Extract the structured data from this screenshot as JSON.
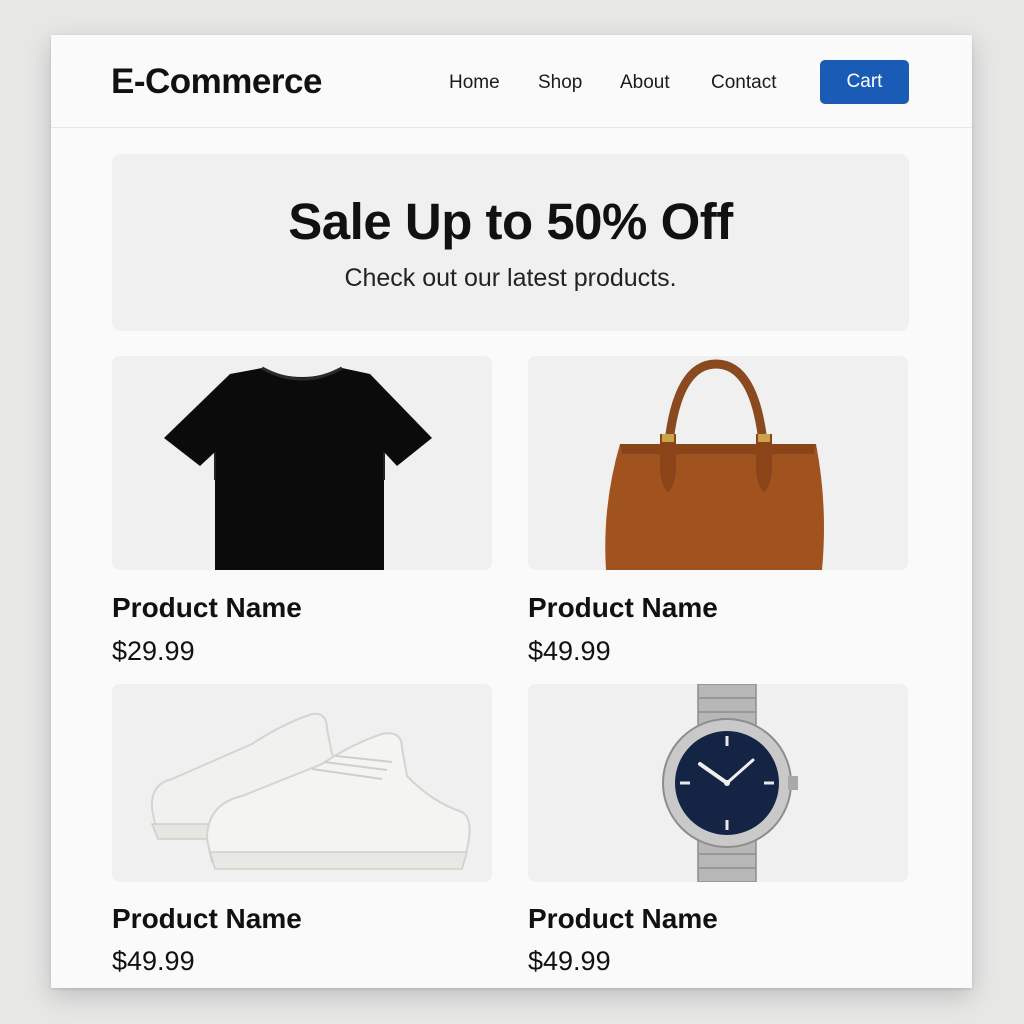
{
  "header": {
    "brand": "E-Commerce",
    "nav": [
      "Home",
      "Shop",
      "About",
      "Contact"
    ],
    "cart_label": "Cart",
    "accent_color": "#1a5bb5"
  },
  "banner": {
    "title": "Sale Up to 50% Off",
    "subtitle": "Check out our latest products."
  },
  "products": [
    {
      "name": "Product Name",
      "price": "$29.99",
      "image": "black-tshirt"
    },
    {
      "name": "Product Name",
      "price": "$49.99",
      "image": "brown-leather-handbag"
    },
    {
      "name": "Product Name",
      "price": "$49.99",
      "image": "white-sneakers"
    },
    {
      "name": "Product Name",
      "price": "$49.99",
      "image": "silver-wristwatch"
    }
  ]
}
